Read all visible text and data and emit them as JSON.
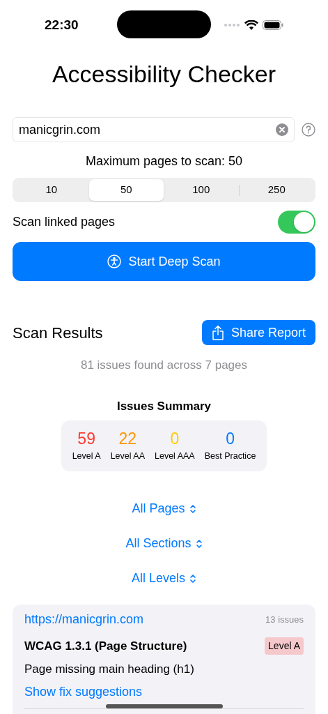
{
  "status_bar": {
    "time": "22:30"
  },
  "title": "Accessibility Checker",
  "url_field": {
    "value": "manicgrin.com"
  },
  "max_pages_label": "Maximum pages to scan: 50",
  "page_options": [
    {
      "label": "10",
      "selected": false
    },
    {
      "label": "50",
      "selected": true
    },
    {
      "label": "100",
      "selected": false
    },
    {
      "label": "250",
      "selected": false
    }
  ],
  "scan_linked": {
    "label": "Scan linked pages",
    "on": true
  },
  "start_button": "Start Deep Scan",
  "results": {
    "title": "Scan Results",
    "share_button": "Share Report",
    "subtitle": "81 issues found across 7 pages"
  },
  "summary": {
    "title": "Issues Summary",
    "items": [
      {
        "count": "59",
        "label": "Level A",
        "color": "#ff3b30"
      },
      {
        "count": "22",
        "label": "Level AA",
        "color": "#ff9500"
      },
      {
        "count": "0",
        "label": "Level AAA",
        "color": "#ffcc00"
      },
      {
        "count": "0",
        "label": "Best Practice",
        "color": "#007aff"
      }
    ]
  },
  "filters": [
    "All Pages",
    "All Sections",
    "All Levels"
  ],
  "page_card": {
    "url": "https://manicgrin.com",
    "count": "13 issues",
    "issues": [
      {
        "rule": "WCAG 1.3.1 (Page Structure)",
        "level": "Level A",
        "description": "Page missing main heading (h1)",
        "link": "Show fix suggestions"
      }
    ]
  }
}
